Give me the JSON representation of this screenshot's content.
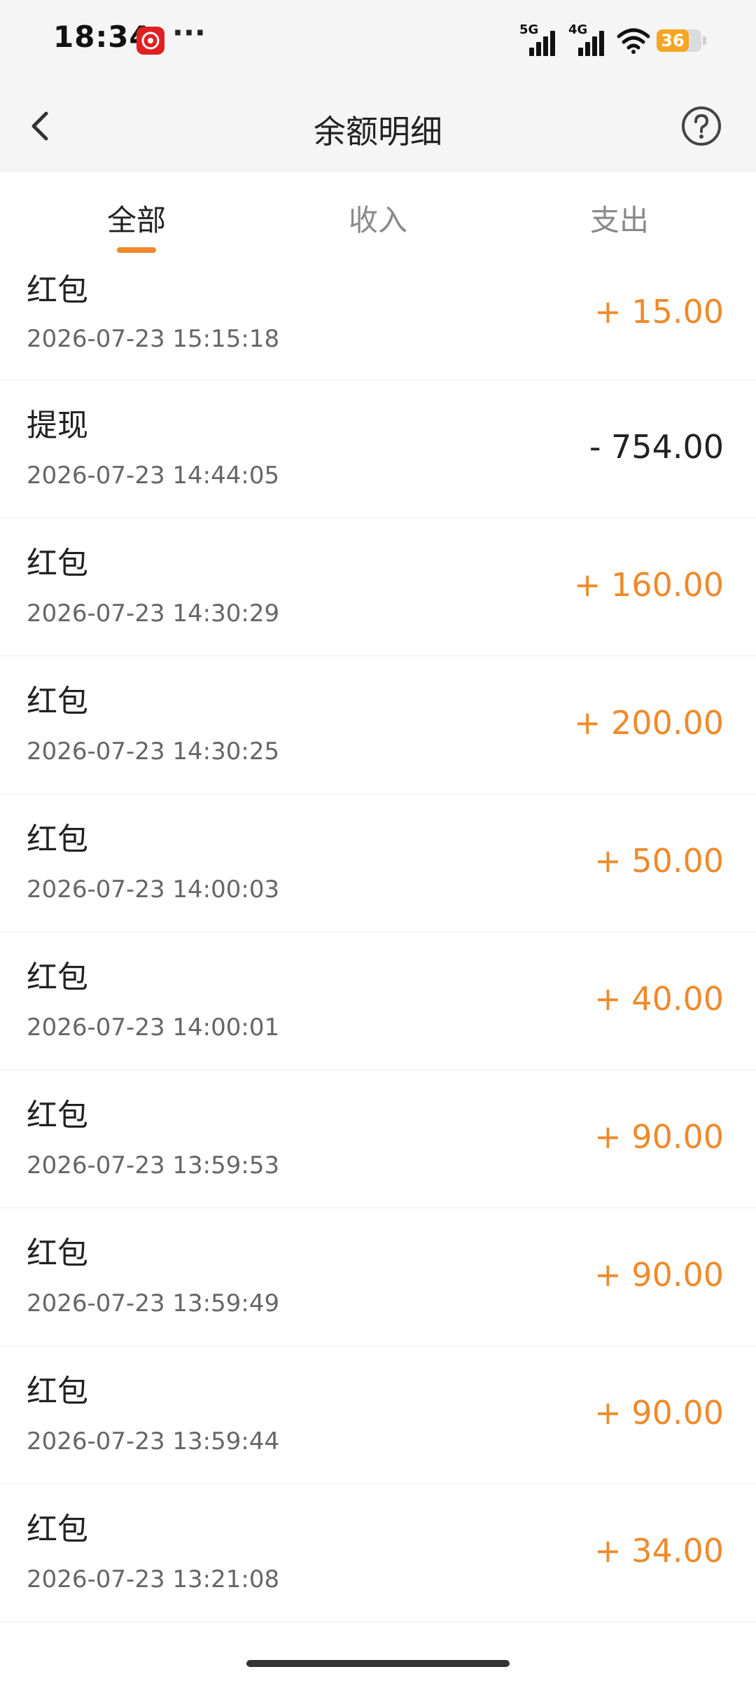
{
  "status_bar": {
    "time": "18:34",
    "dots": "···",
    "signal1_label": "5G",
    "signal2_label": "4G",
    "battery": "36",
    "battery_level": 0.36,
    "battery_color": "#f5a623",
    "app_badge_color": "#e02020"
  },
  "header": {
    "title": "余额明细",
    "back_icon": "chevron-left-icon",
    "help_icon": "question-circle-icon"
  },
  "tabs": [
    {
      "label": "全部",
      "active": true
    },
    {
      "label": "收入",
      "active": false
    },
    {
      "label": "支出",
      "active": false
    }
  ],
  "colors": {
    "accent": "#ee8a2a",
    "text_primary": "#222222",
    "text_secondary": "#666666"
  },
  "transactions": [
    {
      "title": "红包",
      "time": "2026-07-23 15:15:18",
      "amount": "+ 15.00",
      "type": "income"
    },
    {
      "title": "提现",
      "time": "2026-07-23 14:44:05",
      "amount": "- 754.00",
      "type": "expense"
    },
    {
      "title": "红包",
      "time": "2026-07-23 14:30:29",
      "amount": "+ 160.00",
      "type": "income"
    },
    {
      "title": "红包",
      "time": "2026-07-23 14:30:25",
      "amount": "+ 200.00",
      "type": "income"
    },
    {
      "title": "红包",
      "time": "2026-07-23 14:00:03",
      "amount": "+ 50.00",
      "type": "income"
    },
    {
      "title": "红包",
      "time": "2026-07-23 14:00:01",
      "amount": "+ 40.00",
      "type": "income"
    },
    {
      "title": "红包",
      "time": "2026-07-23 13:59:53",
      "amount": "+ 90.00",
      "type": "income"
    },
    {
      "title": "红包",
      "time": "2026-07-23 13:59:49",
      "amount": "+ 90.00",
      "type": "income"
    },
    {
      "title": "红包",
      "time": "2026-07-23 13:59:44",
      "amount": "+ 90.00",
      "type": "income"
    },
    {
      "title": "红包",
      "time": "2026-07-23 13:21:08",
      "amount": "+ 34.00",
      "type": "income"
    }
  ]
}
